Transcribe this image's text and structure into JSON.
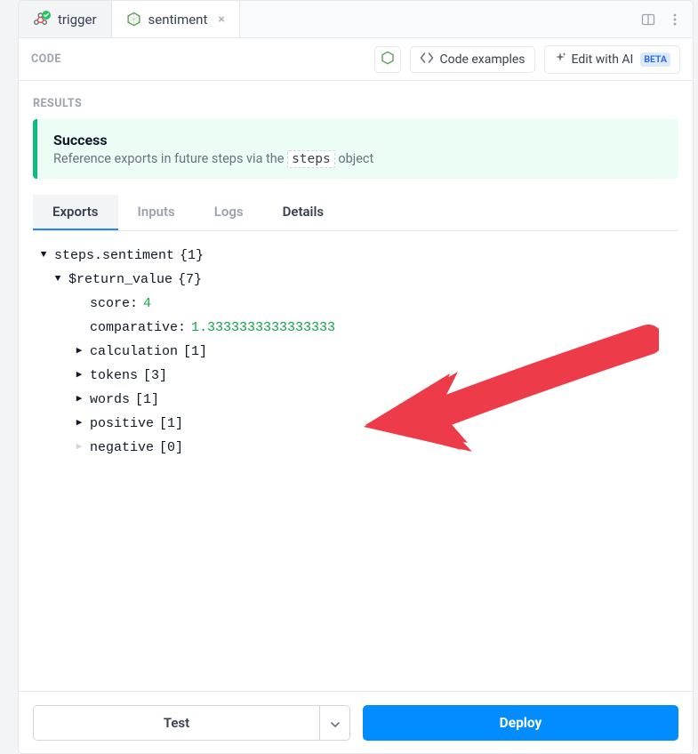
{
  "tabs": [
    {
      "label": "trigger",
      "active": false
    },
    {
      "label": "sentiment",
      "active": true
    }
  ],
  "sections": {
    "code_label": "CODE",
    "results_label": "RESULTS"
  },
  "code_actions": {
    "code_examples": "Code examples",
    "edit_with_ai": "Edit with AI",
    "beta": "BETA"
  },
  "success": {
    "title": "Success",
    "desc_prefix": "Reference exports in future steps via the ",
    "steps_code": "steps",
    "desc_suffix": " object"
  },
  "result_tabs": {
    "exports": "Exports",
    "inputs": "Inputs",
    "logs": "Logs",
    "details": "Details"
  },
  "tree": {
    "root": {
      "key": "steps.sentiment",
      "count": "{1}"
    },
    "return_value": {
      "key": "$return_value",
      "count": "{7}"
    },
    "score": {
      "key": "score:",
      "value": "4"
    },
    "comparative": {
      "key": "comparative:",
      "value": "1.3333333333333333"
    },
    "calculation": {
      "key": "calculation",
      "count": "[1]"
    },
    "tokens": {
      "key": "tokens",
      "count": "[3]"
    },
    "words": {
      "key": "words",
      "count": "[1]"
    },
    "positive": {
      "key": "positive",
      "count": "[1]"
    },
    "negative": {
      "key": "negative",
      "count": "[0]"
    }
  },
  "footer": {
    "test": "Test",
    "deploy": "Deploy"
  }
}
